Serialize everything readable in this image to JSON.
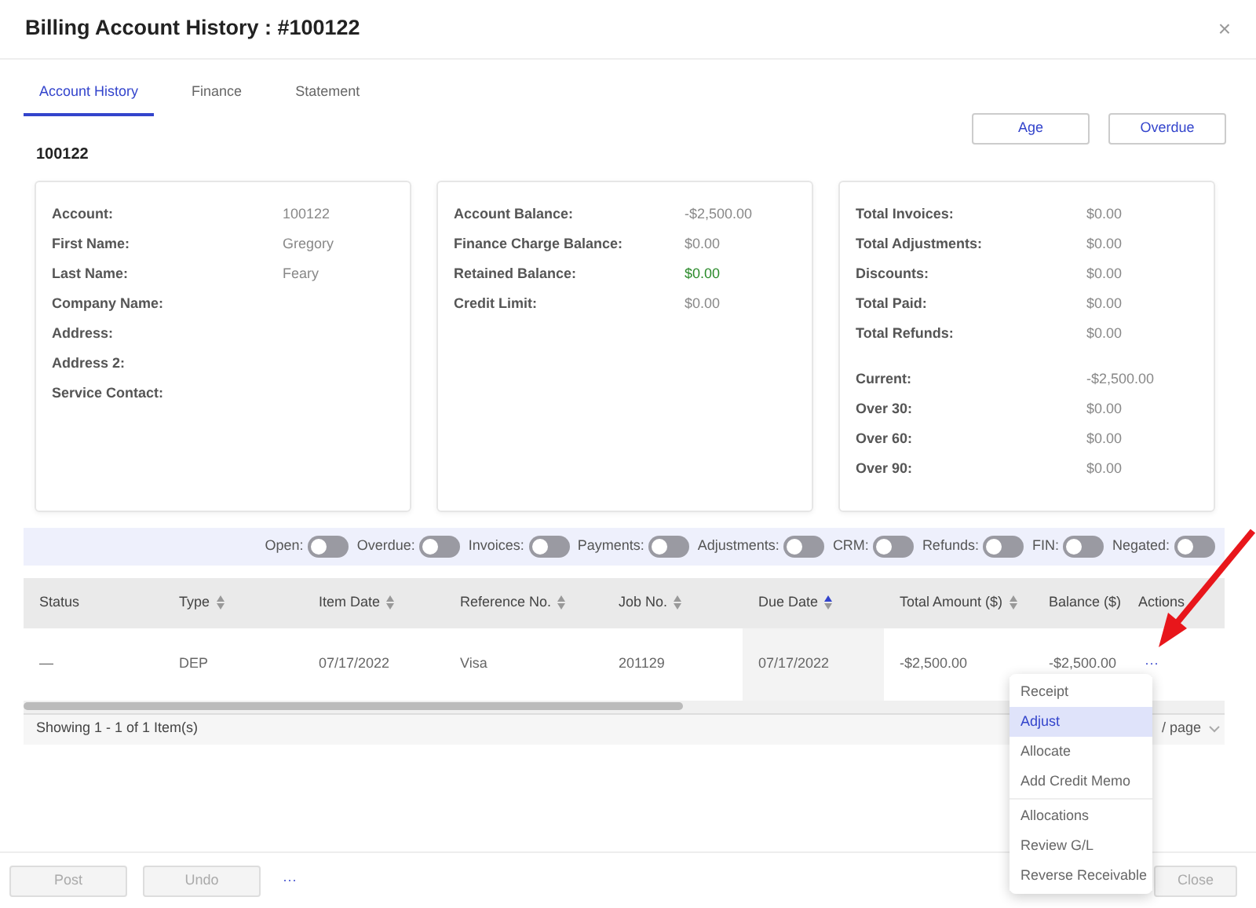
{
  "window": {
    "title": "Billing Account History : #100122",
    "close": "×"
  },
  "tabs": [
    {
      "label": "Account History",
      "selected": true
    },
    {
      "label": "Finance",
      "selected": false
    },
    {
      "label": "Statement",
      "selected": false
    }
  ],
  "header_buttons": [
    "Age",
    "Overdue"
  ],
  "account_number": "100122",
  "cards": [
    {
      "groups": [
        [
          {
            "label": "Account:",
            "value": "100122"
          },
          {
            "label": "First Name:",
            "value": "Gregory"
          },
          {
            "label": "Last Name:",
            "value": "Feary"
          },
          {
            "label": "Company Name:"
          },
          {
            "label": "Address:"
          },
          {
            "label": "Address 2:"
          },
          {
            "label": "Service Contact:"
          }
        ]
      ]
    },
    {
      "groups": [
        [
          {
            "label": "Account Balance:",
            "value": "-$2,500.00"
          },
          {
            "label": "Finance Charge Balance:",
            "value": "$0.00"
          },
          {
            "label": "Retained Balance:",
            "value": "$0.00",
            "positive": true
          },
          {
            "label": "Credit Limit:",
            "value": "$0.00"
          }
        ]
      ]
    },
    {
      "groups": [
        [
          {
            "label": "Total Invoices:",
            "value": "$0.00"
          },
          {
            "label": "Total Adjustments:",
            "value": "$0.00"
          },
          {
            "label": "Discounts:",
            "value": "$0.00"
          },
          {
            "label": "Total Paid:",
            "value": "$0.00"
          },
          {
            "label": "Total Refunds:",
            "value": "$0.00"
          }
        ],
        [
          {
            "label": "Current:",
            "value": "-$2,500.00"
          },
          {
            "label": "Over 30:",
            "value": "$0.00"
          },
          {
            "label": "Over 60:",
            "value": "$0.00"
          },
          {
            "label": "Over 90:",
            "value": "$0.00"
          }
        ]
      ]
    }
  ],
  "filters": [
    {
      "label": "Open:",
      "on": false
    },
    {
      "label": "Overdue:",
      "on": false
    },
    {
      "label": "Invoices:",
      "on": false
    },
    {
      "label": "Payments:",
      "on": false
    },
    {
      "label": "Adjustments:",
      "on": false
    },
    {
      "label": "CRM:",
      "on": false
    },
    {
      "label": "Refunds:",
      "on": false
    },
    {
      "label": "FIN:",
      "on": false
    },
    {
      "label": "Negated:",
      "on": false
    }
  ],
  "table": {
    "columns": [
      {
        "label": "Status",
        "sortable": false
      },
      {
        "label": "Type",
        "sortable": true,
        "sorted": false
      },
      {
        "label": "Item Date",
        "sortable": true,
        "sorted": false
      },
      {
        "label": "Reference No.",
        "sortable": true,
        "sorted": false
      },
      {
        "label": "Job No.",
        "sortable": true,
        "sorted": false
      },
      {
        "label": "Due Date",
        "sortable": true,
        "sorted": true
      },
      {
        "label": "Total Amount ($)",
        "sortable": true,
        "sorted": false
      },
      {
        "label": "Balance ($)",
        "sortable": false
      },
      {
        "label": "Actions",
        "sortable": false
      }
    ],
    "rows": [
      {
        "cells": [
          "—",
          "DEP",
          "07/17/2022",
          "Visa",
          "201129",
          "07/17/2022",
          "-$2,500.00",
          "-$2,500.00",
          "···"
        ]
      }
    ]
  },
  "pagination": {
    "summary": "Showing 1 - 1 of 1 Item(s)",
    "page_size": "/ page"
  },
  "action_menu": {
    "groups": [
      [
        {
          "label": "Receipt",
          "selected": false
        },
        {
          "label": "Adjust",
          "selected": true
        },
        {
          "label": "Allocate",
          "selected": false
        },
        {
          "label": "Add Credit Memo",
          "selected": false
        }
      ],
      [
        {
          "label": "Allocations",
          "selected": false
        },
        {
          "label": "Review G/L",
          "selected": false
        },
        {
          "label": "Reverse Receivable",
          "selected": false
        }
      ]
    ]
  },
  "footer": {
    "left": [
      {
        "label": "Post",
        "disabled": true
      },
      {
        "label": "Undo",
        "disabled": true
      }
    ],
    "more": "···",
    "right": [
      {
        "label": "Close",
        "disabled": true
      }
    ]
  }
}
